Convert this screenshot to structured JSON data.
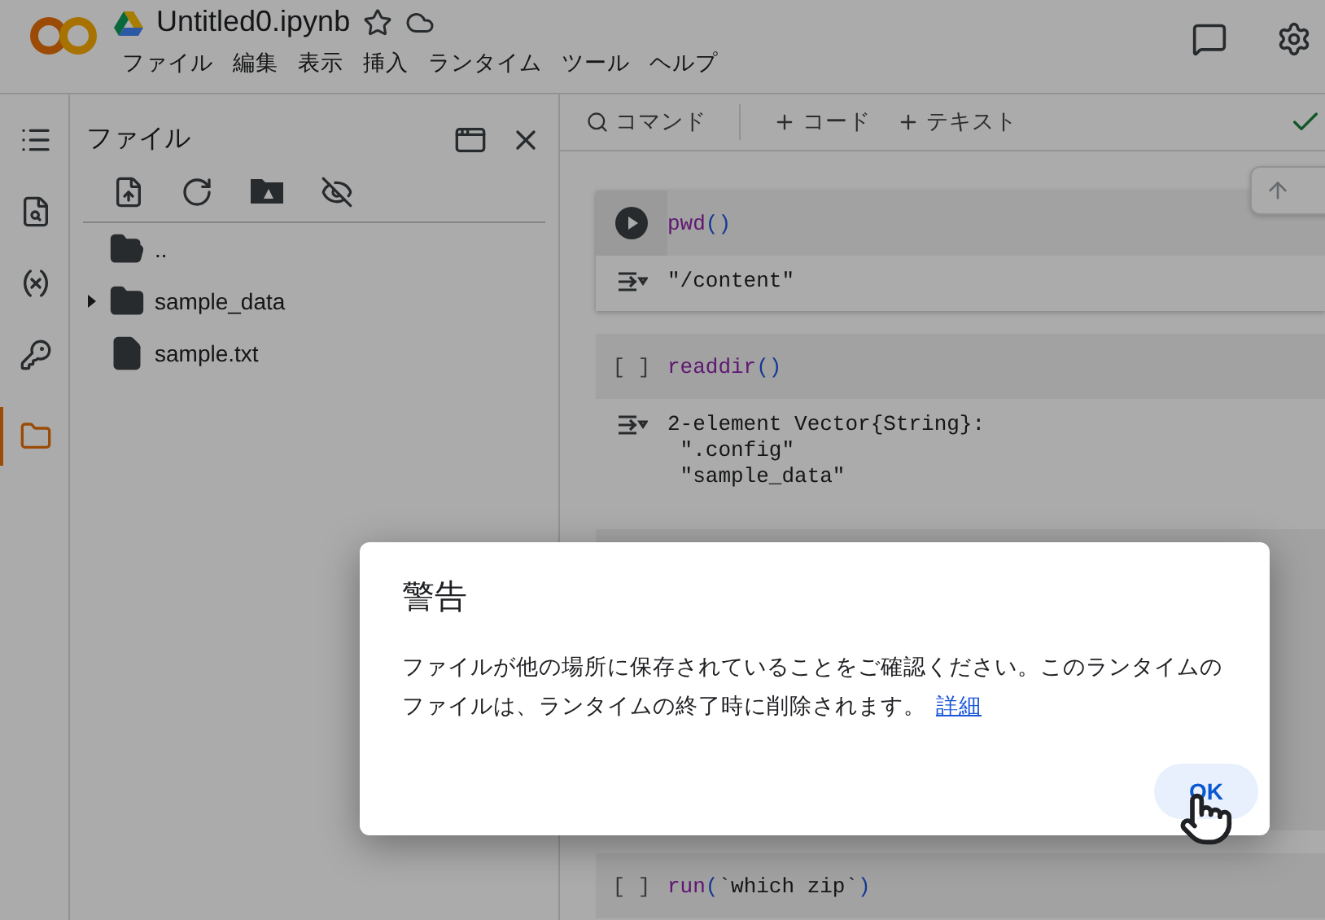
{
  "header": {
    "title": "Untitled0.ipynb",
    "menu": [
      "ファイル",
      "編集",
      "表示",
      "挿入",
      "ランタイム",
      "ツール",
      "ヘルプ"
    ]
  },
  "rail": [
    {
      "kind": "toc",
      "selected": false
    },
    {
      "kind": "find",
      "selected": false
    },
    {
      "kind": "variables",
      "selected": false
    },
    {
      "kind": "secrets",
      "selected": false
    },
    {
      "kind": "files",
      "selected": true
    }
  ],
  "panel": {
    "title": "ファイル",
    "tree": [
      {
        "name": "..",
        "kind": "parent"
      },
      {
        "name": "sample_data",
        "kind": "folder",
        "expanded": false
      },
      {
        "name": "sample.txt",
        "kind": "file"
      }
    ]
  },
  "toolbar": {
    "search": "コマンド",
    "add": [
      "コード",
      "テキスト"
    ]
  },
  "cells": [
    {
      "kind": "code",
      "hovered": true,
      "code": [
        {
          "text": "pwd",
          "kind": "function"
        },
        {
          "text": "()",
          "kind": "paren"
        }
      ],
      "output": [
        "\"/content\""
      ]
    },
    {
      "kind": "code",
      "hovered": false,
      "prompt": "[ ]",
      "code": [
        {
          "text": "readdir",
          "kind": "function"
        },
        {
          "text": "()",
          "kind": "paren"
        }
      ],
      "output": [
        "2-element Vector{String}:",
        " \".config\"",
        " \"sample_data\""
      ]
    },
    {
      "kind": "hidden"
    },
    {
      "kind": "code",
      "hovered": false,
      "prompt": "[ ]",
      "code": [
        {
          "text": "run",
          "kind": "function"
        },
        {
          "text": "(",
          "kind": "paren"
        },
        {
          "text": "`which zip`",
          "kind": "plain"
        },
        {
          "text": ")",
          "kind": "paren"
        }
      ]
    }
  ],
  "dialog": {
    "title": "警告",
    "body": "ファイルが他の場所に保存されていることをご確認ください。このランタイムのファイルは、ランタイムの終了時に削除されます。",
    "link": "詳細",
    "button": "OK"
  }
}
